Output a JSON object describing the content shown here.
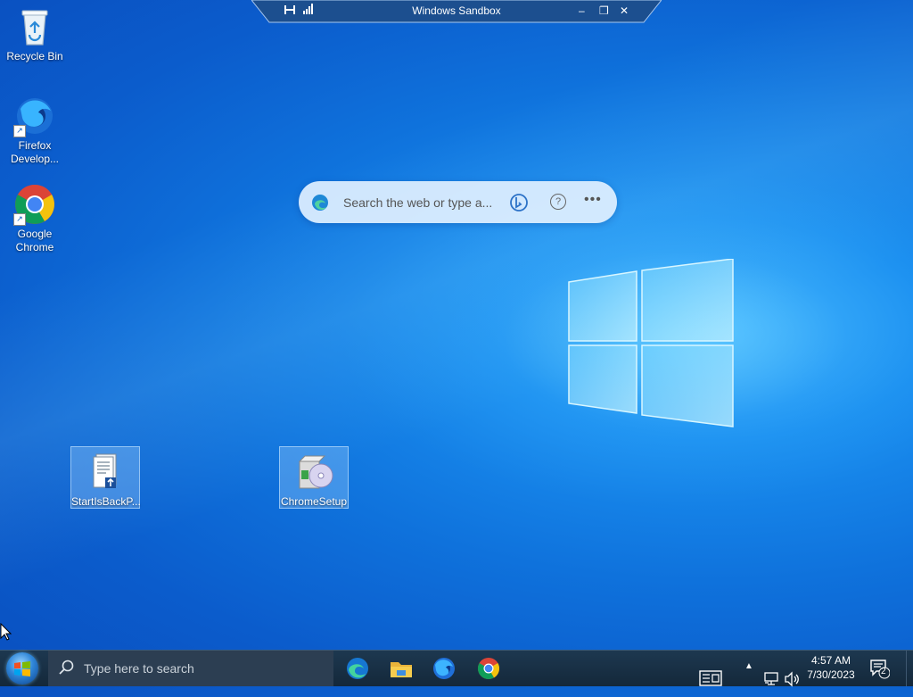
{
  "sandbox_bar": {
    "title": "Windows Sandbox",
    "pin_icon": "pin-icon",
    "signal_icon": "signal-bars-icon",
    "minimize_label": "–",
    "restore_label": "❐",
    "close_label": "✕"
  },
  "desktop_icons": {
    "recycle_bin": "Recycle Bin",
    "firefox_line1": "Firefox",
    "firefox_line2": "Develop...",
    "chrome_line1": "Google",
    "chrome_line2": "Chrome",
    "startisback": "StartIsBackP...",
    "chromesetup": "ChromeSetup"
  },
  "search_widget": {
    "placeholder": "Search the web or type a...",
    "help_label": "?",
    "more_label": "•••"
  },
  "taskbar": {
    "search_placeholder": "Type here to search",
    "apps": [
      "edge-icon",
      "file-explorer-icon",
      "firefox-icon",
      "chrome-icon"
    ],
    "tray_chevron": "▲",
    "time": "4:57 AM",
    "date": "7/30/2023",
    "notification_count": "2"
  },
  "colors": {
    "desktop_blue": "#0f72dc",
    "taskbar": "#1d3850"
  }
}
